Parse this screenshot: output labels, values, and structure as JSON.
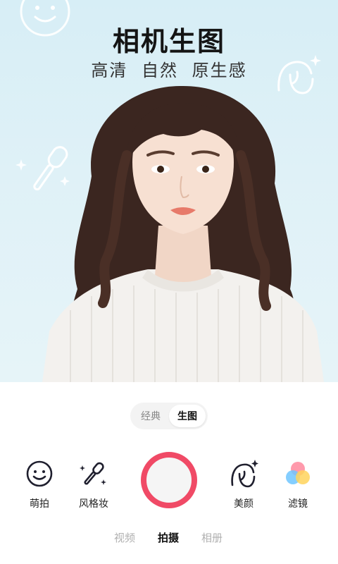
{
  "hero": {
    "title": "相机生图",
    "subtitle": [
      "高清",
      "自然",
      "原生感"
    ]
  },
  "mode_toggle": {
    "options": [
      {
        "label": "经典",
        "active": false
      },
      {
        "label": "生图",
        "active": true
      }
    ]
  },
  "tools": {
    "cute": {
      "label": "萌拍",
      "icon": "smiley-face-icon"
    },
    "style_makeup": {
      "label": "风格妆",
      "icon": "makeup-brush-icon"
    },
    "beauty": {
      "label": "美颜",
      "icon": "face-sparkle-icon"
    },
    "filter": {
      "label": "滤镜",
      "icon": "color-circles-icon"
    }
  },
  "shutter": {
    "icon": "shutter-button",
    "color": "#f04a66"
  },
  "bottom_tabs": [
    {
      "label": "视频",
      "active": false
    },
    {
      "label": "拍摄",
      "active": true
    },
    {
      "label": "相册",
      "active": false
    }
  ],
  "colors": {
    "accent": "#f04a66",
    "hero_bg": "#dbeff6",
    "filter_colors": [
      "#ff8fa3",
      "#ffd35c",
      "#6fc6ff"
    ]
  }
}
